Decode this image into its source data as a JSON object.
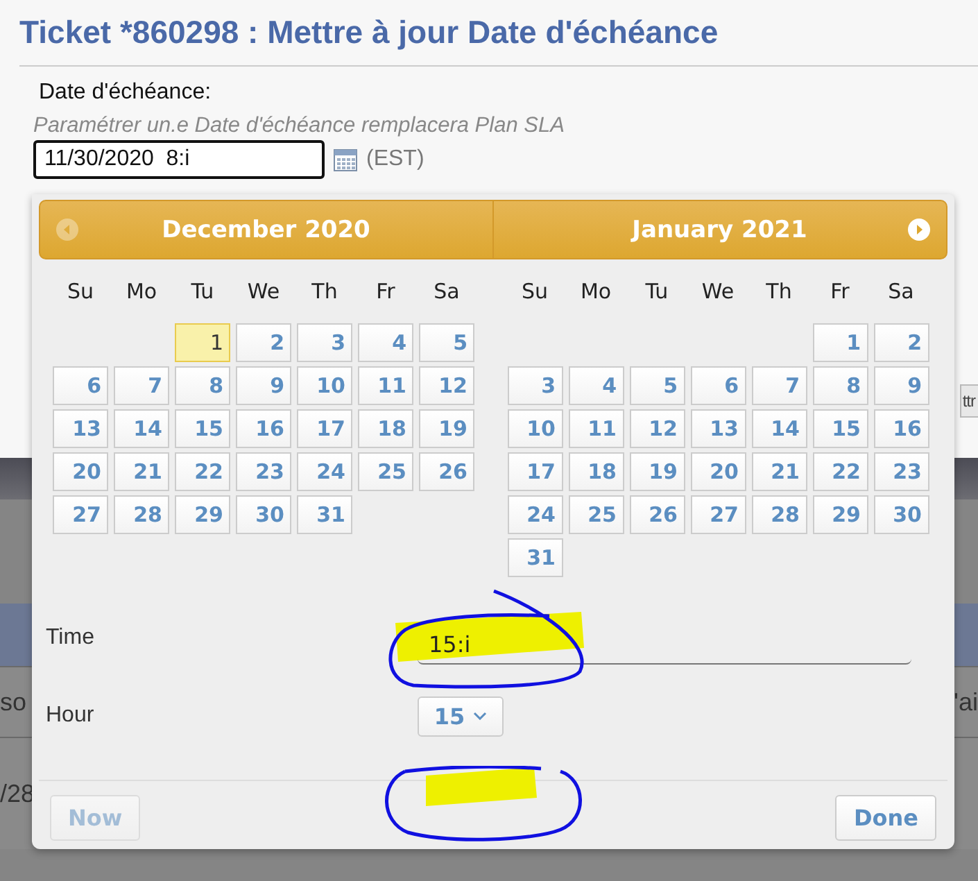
{
  "title": "Ticket *860298 : Mettre à jour Date d'échéance",
  "field": {
    "label": "Date d'échéance:",
    "hint": "Paramétrer un.e Date d'échéance remplacera Plan SLA",
    "value": "11/30/2020  8:i",
    "timezone": "(EST)"
  },
  "behind": {
    "right_button": "ttr",
    "row_left": "so",
    "row_right": "'ai",
    "row2_left": "/28"
  },
  "datepicker": {
    "months": [
      {
        "title": "December 2020",
        "nav": {
          "kind": "prev",
          "disabled": true
        },
        "weekdays": [
          "Su",
          "Mo",
          "Tu",
          "We",
          "Th",
          "Fr",
          "Sa"
        ],
        "weeks": [
          [
            {
              "kind": "blank"
            },
            {
              "kind": "blank"
            },
            {
              "day": "1",
              "today": true
            },
            {
              "day": "2",
              "today": false
            },
            {
              "day": "3",
              "today": false
            },
            {
              "day": "4",
              "today": false
            },
            {
              "day": "5",
              "today": false
            }
          ],
          [
            {
              "day": "6",
              "today": false
            },
            {
              "day": "7",
              "today": false
            },
            {
              "day": "8",
              "today": false
            },
            {
              "day": "9",
              "today": false
            },
            {
              "day": "10",
              "today": false
            },
            {
              "day": "11",
              "today": false
            },
            {
              "day": "12",
              "today": false
            }
          ],
          [
            {
              "day": "13",
              "today": false
            },
            {
              "day": "14",
              "today": false
            },
            {
              "day": "15",
              "today": false
            },
            {
              "day": "16",
              "today": false
            },
            {
              "day": "17",
              "today": false
            },
            {
              "day": "18",
              "today": false
            },
            {
              "day": "19",
              "today": false
            }
          ],
          [
            {
              "day": "20",
              "today": false
            },
            {
              "day": "21",
              "today": false
            },
            {
              "day": "22",
              "today": false
            },
            {
              "day": "23",
              "today": false
            },
            {
              "day": "24",
              "today": false
            },
            {
              "day": "25",
              "today": false
            },
            {
              "day": "26",
              "today": false
            }
          ],
          [
            {
              "day": "27",
              "today": false
            },
            {
              "day": "28",
              "today": false
            },
            {
              "day": "29",
              "today": false
            },
            {
              "day": "30",
              "today": false
            },
            {
              "day": "31",
              "today": false
            },
            {
              "kind": "blank"
            },
            {
              "kind": "blank"
            }
          ]
        ]
      },
      {
        "title": "January 2021",
        "nav": {
          "kind": "next",
          "disabled": false
        },
        "weekdays": [
          "Su",
          "Mo",
          "Tu",
          "We",
          "Th",
          "Fr",
          "Sa"
        ],
        "weeks": [
          [
            {
              "kind": "blank"
            },
            {
              "kind": "blank"
            },
            {
              "kind": "blank"
            },
            {
              "kind": "blank"
            },
            {
              "kind": "blank"
            },
            {
              "day": "1",
              "today": false
            },
            {
              "day": "2",
              "today": false
            }
          ],
          [
            {
              "day": "3",
              "today": false
            },
            {
              "day": "4",
              "today": false
            },
            {
              "day": "5",
              "today": false
            },
            {
              "day": "6",
              "today": false
            },
            {
              "day": "7",
              "today": false
            },
            {
              "day": "8",
              "today": false
            },
            {
              "day": "9",
              "today": false
            }
          ],
          [
            {
              "day": "10",
              "today": false
            },
            {
              "day": "11",
              "today": false
            },
            {
              "day": "12",
              "today": false
            },
            {
              "day": "13",
              "today": false
            },
            {
              "day": "14",
              "today": false
            },
            {
              "day": "15",
              "today": false
            },
            {
              "day": "16",
              "today": false
            }
          ],
          [
            {
              "day": "17",
              "today": false
            },
            {
              "day": "18",
              "today": false
            },
            {
              "day": "19",
              "today": false
            },
            {
              "day": "20",
              "today": false
            },
            {
              "day": "21",
              "today": false
            },
            {
              "day": "22",
              "today": false
            },
            {
              "day": "23",
              "today": false
            }
          ],
          [
            {
              "day": "24",
              "today": false
            },
            {
              "day": "25",
              "today": false
            },
            {
              "day": "26",
              "today": false
            },
            {
              "day": "27",
              "today": false
            },
            {
              "day": "28",
              "today": false
            },
            {
              "day": "29",
              "today": false
            },
            {
              "day": "30",
              "today": false
            }
          ],
          [
            {
              "day": "31",
              "today": false
            },
            {
              "kind": "blank"
            },
            {
              "kind": "blank"
            },
            {
              "kind": "blank"
            },
            {
              "kind": "blank"
            },
            {
              "kind": "blank"
            },
            {
              "kind": "blank"
            }
          ]
        ]
      }
    ],
    "time": {
      "label": "Time",
      "value": "15:i"
    },
    "hour": {
      "label": "Hour",
      "value": "15"
    },
    "buttons": [
      {
        "label": "Now",
        "disabled": true
      },
      {
        "label": "Done",
        "disabled": false
      }
    ]
  }
}
